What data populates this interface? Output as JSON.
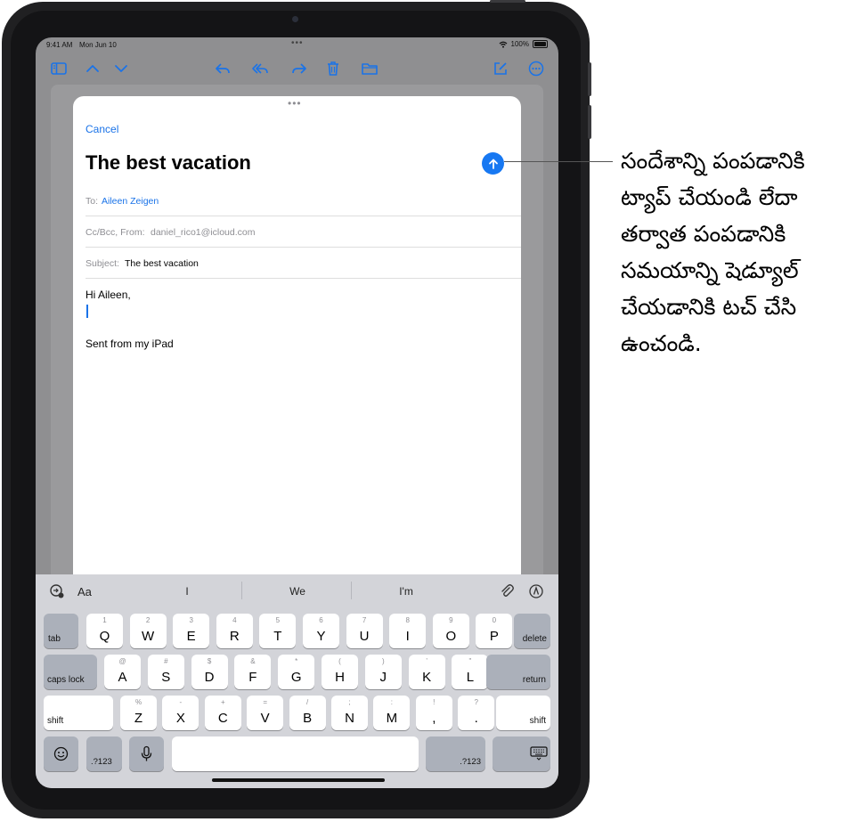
{
  "status_bar": {
    "time": "9:41 AM",
    "date": "Mon Jun 10",
    "battery": "100%"
  },
  "toolbar": {
    "icons": [
      "sidebar-icon",
      "chevron-up-icon",
      "chevron-down-icon",
      "reply-icon",
      "reply-all-icon",
      "forward-icon",
      "trash-icon",
      "folder-icon",
      "compose-icon",
      "more-icon"
    ]
  },
  "compose": {
    "cancel_label": "Cancel",
    "title": "The best vacation",
    "to_label": "To:",
    "to_value": "Aileen Zeigen",
    "ccbcc_label": "Cc/Bcc, From:",
    "from_value": "daniel_rico1@icloud.com",
    "subject_label": "Subject:",
    "subject_value": "The best vacation",
    "greeting": "Hi Aileen,",
    "signature": "Sent from my iPad"
  },
  "suggestions": {
    "items": [
      "I",
      "We",
      "I'm"
    ],
    "format_label": "Aa"
  },
  "keyboard": {
    "row1": [
      {
        "main": "Q",
        "alt": "1"
      },
      {
        "main": "W",
        "alt": "2"
      },
      {
        "main": "E",
        "alt": "3"
      },
      {
        "main": "R",
        "alt": "4"
      },
      {
        "main": "T",
        "alt": "5"
      },
      {
        "main": "Y",
        "alt": "6"
      },
      {
        "main": "U",
        "alt": "7"
      },
      {
        "main": "I",
        "alt": "8"
      },
      {
        "main": "O",
        "alt": "9"
      },
      {
        "main": "P",
        "alt": "0"
      }
    ],
    "row2": [
      {
        "main": "A",
        "alt": "@"
      },
      {
        "main": "S",
        "alt": "#"
      },
      {
        "main": "D",
        "alt": "$"
      },
      {
        "main": "F",
        "alt": "&"
      },
      {
        "main": "G",
        "alt": "*"
      },
      {
        "main": "H",
        "alt": "("
      },
      {
        "main": "J",
        "alt": ")"
      },
      {
        "main": "K",
        "alt": "’"
      },
      {
        "main": "L",
        "alt": "\""
      }
    ],
    "row3": [
      {
        "main": "Z",
        "alt": "%"
      },
      {
        "main": "X",
        "alt": "-"
      },
      {
        "main": "C",
        "alt": "+"
      },
      {
        "main": "V",
        "alt": "="
      },
      {
        "main": "B",
        "alt": "/"
      },
      {
        "main": "N",
        "alt": ";"
      },
      {
        "main": "M",
        "alt": ":"
      },
      {
        "main": ",",
        "alt": "!"
      },
      {
        "main": ".",
        "alt": "?"
      }
    ],
    "tab_label": "tab",
    "delete_label": "delete",
    "caps_label": "caps lock",
    "return_label": "return",
    "shift_label": "shift",
    "numbers_label": ".?123"
  },
  "callout": "సందేశాన్ని పంపడానికి ట్యాప్ చేయండి లేదా తర్వాత పంపడానికి సమయాన్ని షెడ్యూల్ చేయడానికి టచ్ చేసి ఉంచండి."
}
